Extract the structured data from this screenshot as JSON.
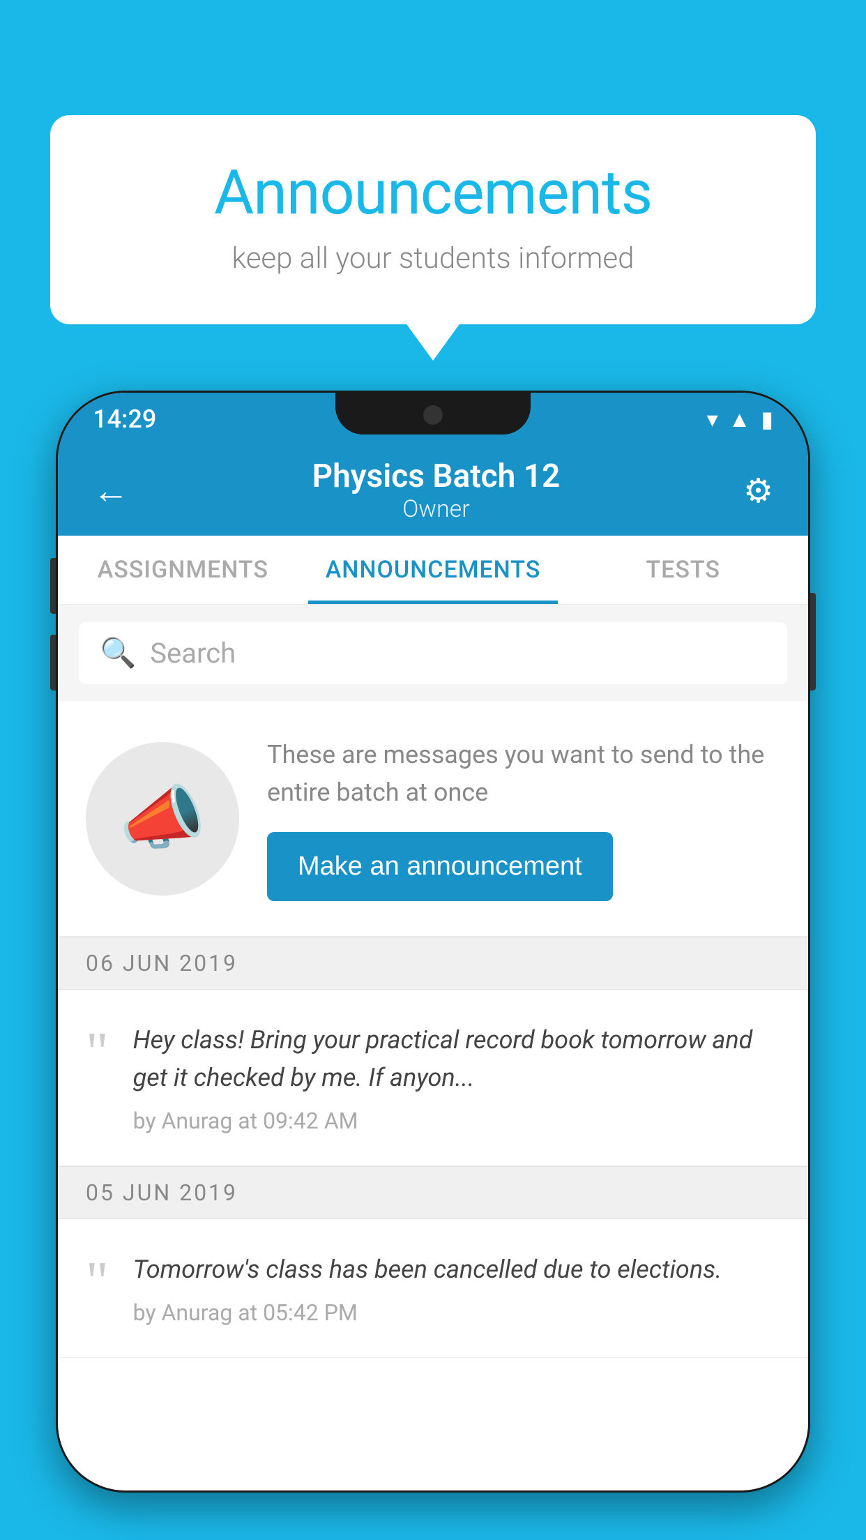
{
  "background_color": "#1ab8e8",
  "bubble": {
    "title": "Announcements",
    "subtitle": "keep all your students informed"
  },
  "phone": {
    "status_bar": {
      "time": "14:29",
      "icons": [
        "wifi",
        "signal",
        "battery"
      ]
    },
    "header": {
      "title": "Physics Batch 12",
      "subtitle": "Owner",
      "back_label": "←",
      "gear_label": "⚙"
    },
    "tabs": [
      {
        "label": "ASSIGNMENTS",
        "active": false
      },
      {
        "label": "ANNOUNCEMENTS",
        "active": true
      },
      {
        "label": "TESTS",
        "active": false
      }
    ],
    "search": {
      "placeholder": "Search"
    },
    "announcement_prompt": {
      "description": "These are messages you want to send to the entire batch at once",
      "button_label": "Make an announcement"
    },
    "announcements": [
      {
        "date": "06  JUN  2019",
        "text": "Hey class! Bring your practical record book tomorrow and get it checked by me. If anyon...",
        "meta": "by Anurag at 09:42 AM"
      },
      {
        "date": "05  JUN  2019",
        "text": "Tomorrow's class has been cancelled due to elections.",
        "meta": "by Anurag at 05:42 PM"
      }
    ]
  }
}
